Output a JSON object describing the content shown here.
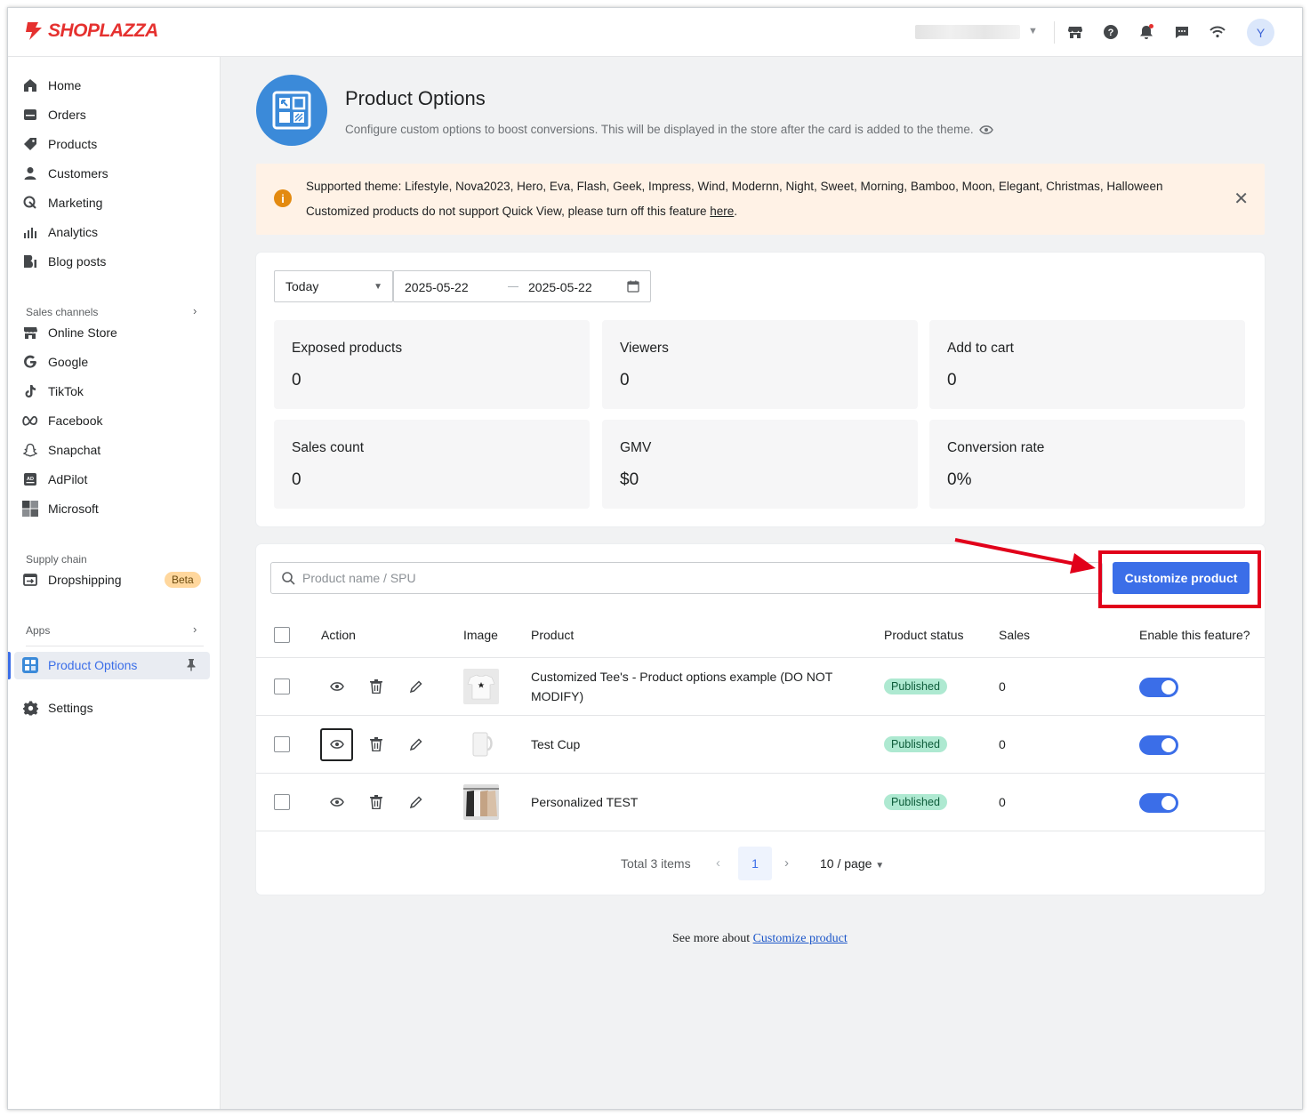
{
  "brand": {
    "name": "SHOPLAZZA",
    "color": "#e5312f"
  },
  "topbar": {
    "avatar_initial": "Y",
    "icons": [
      "store-icon",
      "help-icon",
      "bell-icon",
      "chat-icon",
      "wifi-icon"
    ]
  },
  "sidebar": {
    "items": [
      {
        "label": "Home",
        "icon": "home-icon"
      },
      {
        "label": "Orders",
        "icon": "orders-icon"
      },
      {
        "label": "Products",
        "icon": "tag-icon"
      },
      {
        "label": "Customers",
        "icon": "person-icon"
      },
      {
        "label": "Marketing",
        "icon": "marketing-icon"
      },
      {
        "label": "Analytics",
        "icon": "analytics-icon"
      },
      {
        "label": "Blog posts",
        "icon": "blog-icon"
      }
    ],
    "sales_channels_title": "Sales channels",
    "channels": [
      {
        "label": "Online Store",
        "icon": "store-icon"
      },
      {
        "label": "Google",
        "icon": "google-icon"
      },
      {
        "label": "TikTok",
        "icon": "tiktok-icon"
      },
      {
        "label": "Facebook",
        "icon": "meta-icon"
      },
      {
        "label": "Snapchat",
        "icon": "snapchat-icon"
      },
      {
        "label": "AdPilot",
        "icon": "adpilot-icon"
      },
      {
        "label": "Microsoft",
        "icon": "microsoft-icon"
      }
    ],
    "supply_chain_title": "Supply chain",
    "dropshipping": {
      "label": "Dropshipping",
      "badge": "Beta"
    },
    "apps_title": "Apps",
    "active_app": "Product Options",
    "settings": "Settings"
  },
  "header": {
    "title": "Product Options",
    "subtitle": "Configure custom options to boost conversions. This will be displayed in the store after the card is added to the theme."
  },
  "banner": {
    "line1": "Supported theme: Lifestyle, Nova2023, Hero, Eva, Flash, Geek, Impress, Wind, Modernn, Night, Sweet, Morning, Bamboo, Moon, Elegant, Christmas, Halloween",
    "line2_prefix": "Customized products do not support Quick View, please turn off this feature ",
    "line2_link": "here",
    "line2_suffix": "."
  },
  "filter": {
    "period": "Today",
    "start_date": "2025-05-22",
    "end_date": "2025-05-22"
  },
  "stats": [
    {
      "label": "Exposed products",
      "value": "0"
    },
    {
      "label": "Viewers",
      "value": "0"
    },
    {
      "label": "Add to cart",
      "value": "0"
    },
    {
      "label": "Sales count",
      "value": "0"
    },
    {
      "label": "GMV",
      "value": "$0"
    },
    {
      "label": "Conversion rate",
      "value": "0%"
    }
  ],
  "search": {
    "placeholder": "Product name / SPU"
  },
  "customize_button": "Customize product",
  "table": {
    "headers": {
      "action": "Action",
      "image": "Image",
      "product": "Product",
      "status": "Product status",
      "sales": "Sales",
      "enable": "Enable this feature?"
    },
    "rows": [
      {
        "product": "Customized Tee's - Product options example (DO NOT MODIFY)",
        "status": "Published",
        "sales": "0",
        "enabled": true
      },
      {
        "product": "Test Cup",
        "status": "Published",
        "sales": "0",
        "enabled": true
      },
      {
        "product": "Personalized TEST",
        "status": "Published",
        "sales": "0",
        "enabled": true
      }
    ]
  },
  "pagination": {
    "total": "Total 3 items",
    "current": "1",
    "page_size": "10 / page"
  },
  "footer": {
    "prefix": "See more about ",
    "link": "Customize product"
  }
}
